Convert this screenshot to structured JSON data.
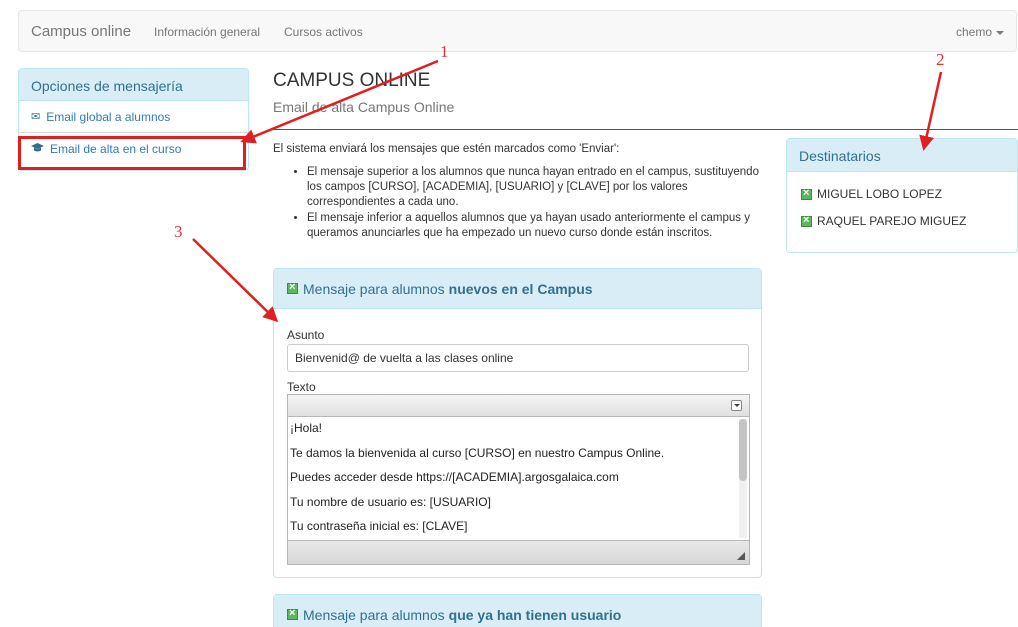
{
  "navbar": {
    "brand": "Campus online",
    "links": [
      "Información general",
      "Cursos activos"
    ],
    "user": "chemo"
  },
  "sidebar": {
    "title": "Opciones de mensajería",
    "items": [
      {
        "label": "Email global a alumnos",
        "icon": "envelope-icon"
      },
      {
        "label": "Email de alta en el curso",
        "icon": "graduation-cap-icon"
      }
    ]
  },
  "main": {
    "title": "CAMPUS ONLINE",
    "subtitle": "Email de alta Campus Online",
    "intro": "El sistema enviará los mensajes que estén marcados como 'Enviar':",
    "bullets": [
      "El mensaje superior a los alumnos que nunca hayan entrado en el campus, sustituyendo los campos [CURSO], [ACADEMIA], [USUARIO] y [CLAVE] por los valores correspondientes a cada uno.",
      "El mensaje inferior a aquellos alumnos que ya hayan usado anteriormente el campus y queramos anunciarles que ha empezado un nuevo curso donde están inscritos."
    ]
  },
  "recipients": {
    "title": "Destinatarios",
    "names": [
      "MIGUEL LOBO LOPEZ",
      "RAQUEL PAREJO MIGUEZ"
    ]
  },
  "panel_new": {
    "title_prefix": "Mensaje para alumnos",
    "title_bold": "nuevos en el Campus",
    "subject_label": "Asunto",
    "subject_value": "Bienvenid@ de vuelta a las clases online",
    "text_label": "Texto",
    "lines": [
      "¡Hola!",
      "Te damos la bienvenida al curso [CURSO] en nuestro Campus Online.",
      "Puedes acceder desde https://[ACADEMIA].argosgalaica.com",
      "Tu nombre de usuario es: [USUARIO]",
      "Tu contraseña inicial es: [CLAVE]"
    ]
  },
  "panel_existing": {
    "title_prefix": "Mensaje para alumnos",
    "title_bold": "que ya han tienen usuario"
  },
  "annotations": [
    "1",
    "2",
    "3"
  ],
  "colors": {
    "annotation_red": "#e02020",
    "panel_header_bg": "#d9edf7",
    "panel_header_text": "#31708f",
    "link": "#337ab7",
    "checkbox_green": "#5cb85c"
  }
}
